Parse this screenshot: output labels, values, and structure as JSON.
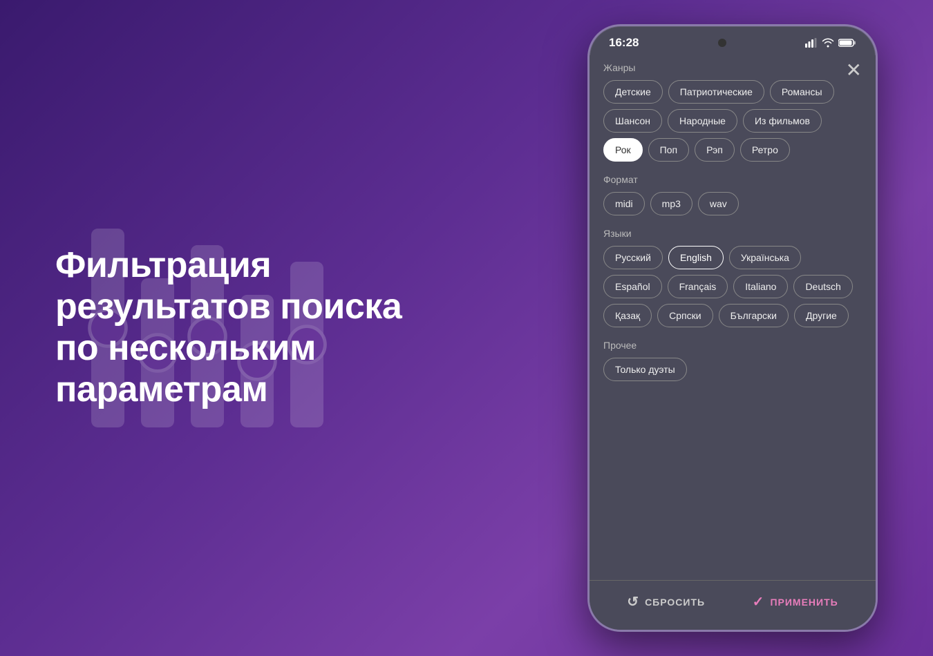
{
  "background": {
    "gradient_start": "#3a1a6e",
    "gradient_end": "#6a2f9a"
  },
  "left": {
    "title": "Фильтрация результатов поиска по нескольким параметрам"
  },
  "phone": {
    "status": {
      "time": "16:28"
    },
    "close_label": "×",
    "sections": [
      {
        "id": "genres",
        "label": "Жанры",
        "tags": [
          {
            "id": "detskie",
            "label": "Детские",
            "active": false
          },
          {
            "id": "patrioticheskie",
            "label": "Патриотические",
            "active": false
          },
          {
            "id": "romansy",
            "label": "Романсы",
            "active": false
          },
          {
            "id": "shanson",
            "label": "Шансон",
            "active": false
          },
          {
            "id": "narodnye",
            "label": "Народные",
            "active": false
          },
          {
            "id": "iz-filmov",
            "label": "Из фильмов",
            "active": false
          },
          {
            "id": "rok",
            "label": "Рок",
            "active": true
          },
          {
            "id": "pop",
            "label": "Поп",
            "active": false
          },
          {
            "id": "rep",
            "label": "Рэп",
            "active": false
          },
          {
            "id": "retro",
            "label": "Ретро",
            "active": false
          }
        ]
      },
      {
        "id": "format",
        "label": "Формат",
        "tags": [
          {
            "id": "midi",
            "label": "midi",
            "active": false
          },
          {
            "id": "mp3",
            "label": "mp3",
            "active": false
          },
          {
            "id": "wav",
            "label": "wav",
            "active": false
          }
        ]
      },
      {
        "id": "languages",
        "label": "Языки",
        "tags": [
          {
            "id": "russian",
            "label": "Русский",
            "active": false
          },
          {
            "id": "english",
            "label": "English",
            "active": true
          },
          {
            "id": "ukrainian",
            "label": "Українська",
            "active": false
          },
          {
            "id": "espanol",
            "label": "Español",
            "active": false
          },
          {
            "id": "francais",
            "label": "Français",
            "active": false
          },
          {
            "id": "italiano",
            "label": "Italiano",
            "active": false
          },
          {
            "id": "deutsch",
            "label": "Deutsch",
            "active": false
          },
          {
            "id": "kazak",
            "label": "Қазақ",
            "active": false
          },
          {
            "id": "srpski",
            "label": "Српски",
            "active": false
          },
          {
            "id": "balgarski",
            "label": "Български",
            "active": false
          },
          {
            "id": "drugie",
            "label": "Другие",
            "active": false
          }
        ]
      },
      {
        "id": "other",
        "label": "Прочее",
        "tags": [
          {
            "id": "duety",
            "label": "Только дуэты",
            "active": false
          }
        ]
      }
    ],
    "bottom": {
      "reset_label": "СБРОСИТЬ",
      "apply_label": "ПРИМЕНИТЬ"
    }
  }
}
